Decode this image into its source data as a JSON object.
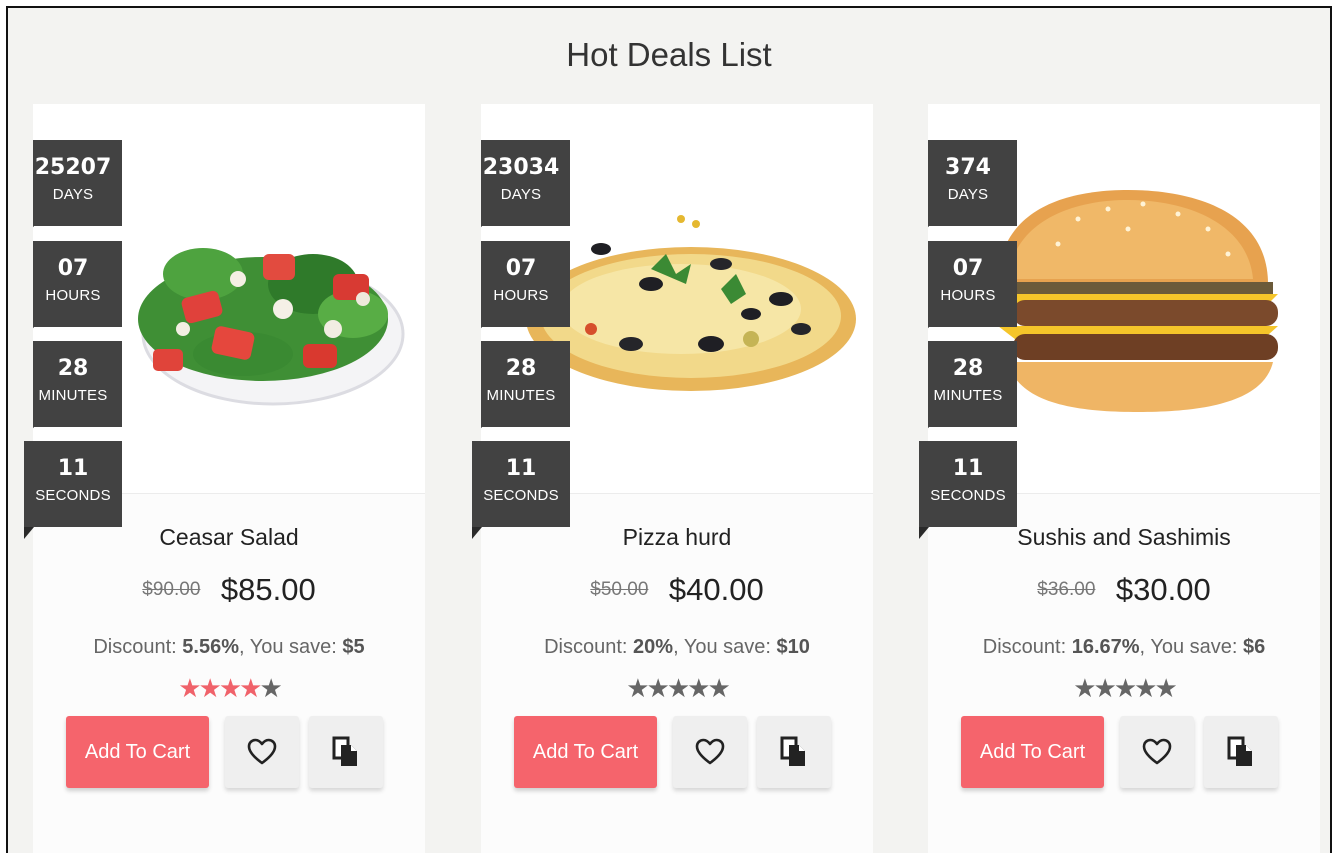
{
  "page": {
    "title": "Hot Deals List"
  },
  "timer_labels": {
    "days": "DAYS",
    "hours": "HOURS",
    "minutes": "MINUTES",
    "seconds": "SECONDS"
  },
  "buttons": {
    "add_to_cart": "Add To Cart"
  },
  "discount_labels": {
    "discount": "Discount: ",
    "you_save": "You save: "
  },
  "products": [
    {
      "name": "Ceasar Salad",
      "image_icon": "salad-image",
      "old_price": "$90.00",
      "new_price": "$85.00",
      "discount": "5.56%",
      "save": "$5",
      "rating": 4,
      "rating_max": 5,
      "timer": {
        "days": "25207",
        "hours": "07",
        "minutes": "28",
        "seconds": "11"
      }
    },
    {
      "name": "Pizza hurd",
      "image_icon": "pizza-image",
      "old_price": "$50.00",
      "new_price": "$40.00",
      "discount": "20%",
      "save": "$10",
      "rating": 0,
      "rating_max": 5,
      "timer": {
        "days": "23034",
        "hours": "07",
        "minutes": "28",
        "seconds": "11"
      }
    },
    {
      "name": "Sushis and Sashimis",
      "image_icon": "burger-image",
      "old_price": "$36.00",
      "new_price": "$30.00",
      "discount": "16.67%",
      "save": "$6",
      "rating": 0,
      "rating_max": 5,
      "timer": {
        "days": "374",
        "hours": "07",
        "minutes": "28",
        "seconds": "11"
      }
    }
  ],
  "colors": {
    "accent": "#f5646c",
    "timer_bg": "#424242",
    "page_bg": "#f3f3f1",
    "star_on": "#f0626a",
    "star_off": "#666666"
  }
}
